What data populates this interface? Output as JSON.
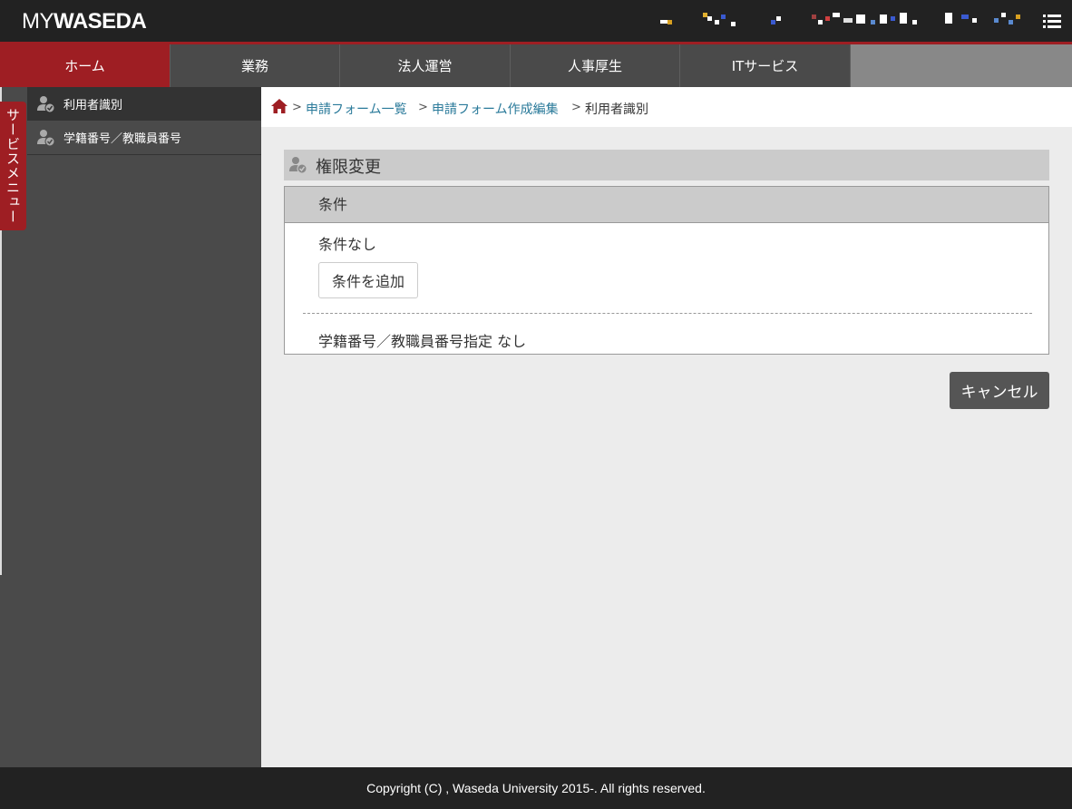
{
  "header": {
    "logo_my": "MY",
    "logo_waseda": "WASEDA"
  },
  "nav": {
    "tabs": [
      {
        "label": "ホーム"
      },
      {
        "label": "業務"
      },
      {
        "label": "法人運営"
      },
      {
        "label": "人事厚生"
      },
      {
        "label": "ITサービス"
      }
    ]
  },
  "sidebar": {
    "service_menu_label": "サービスメニュー",
    "items": [
      {
        "label": "利用者識別"
      },
      {
        "label": "学籍番号／教職員番号"
      }
    ]
  },
  "breadcrumb": {
    "sep": ">",
    "items": [
      {
        "label": "申請フォーム一覧"
      },
      {
        "label": "申請フォーム作成編集"
      },
      {
        "label": "利用者識別"
      }
    ]
  },
  "main": {
    "section_title": "権限変更",
    "condition_header": "条件",
    "condition_none": "条件なし",
    "add_condition_button": "条件を追加",
    "id_spec_text": "学籍番号／教職員番号指定 なし",
    "cancel_button": "キャンセル"
  },
  "footer": {
    "copyright": "Copyright (C) , Waseda University 2015-. All rights reserved."
  },
  "colors": {
    "accent": "#9e1e23",
    "header_bg": "#222222",
    "nav_bg": "#4a4a4a",
    "link": "#2a7a9a"
  }
}
